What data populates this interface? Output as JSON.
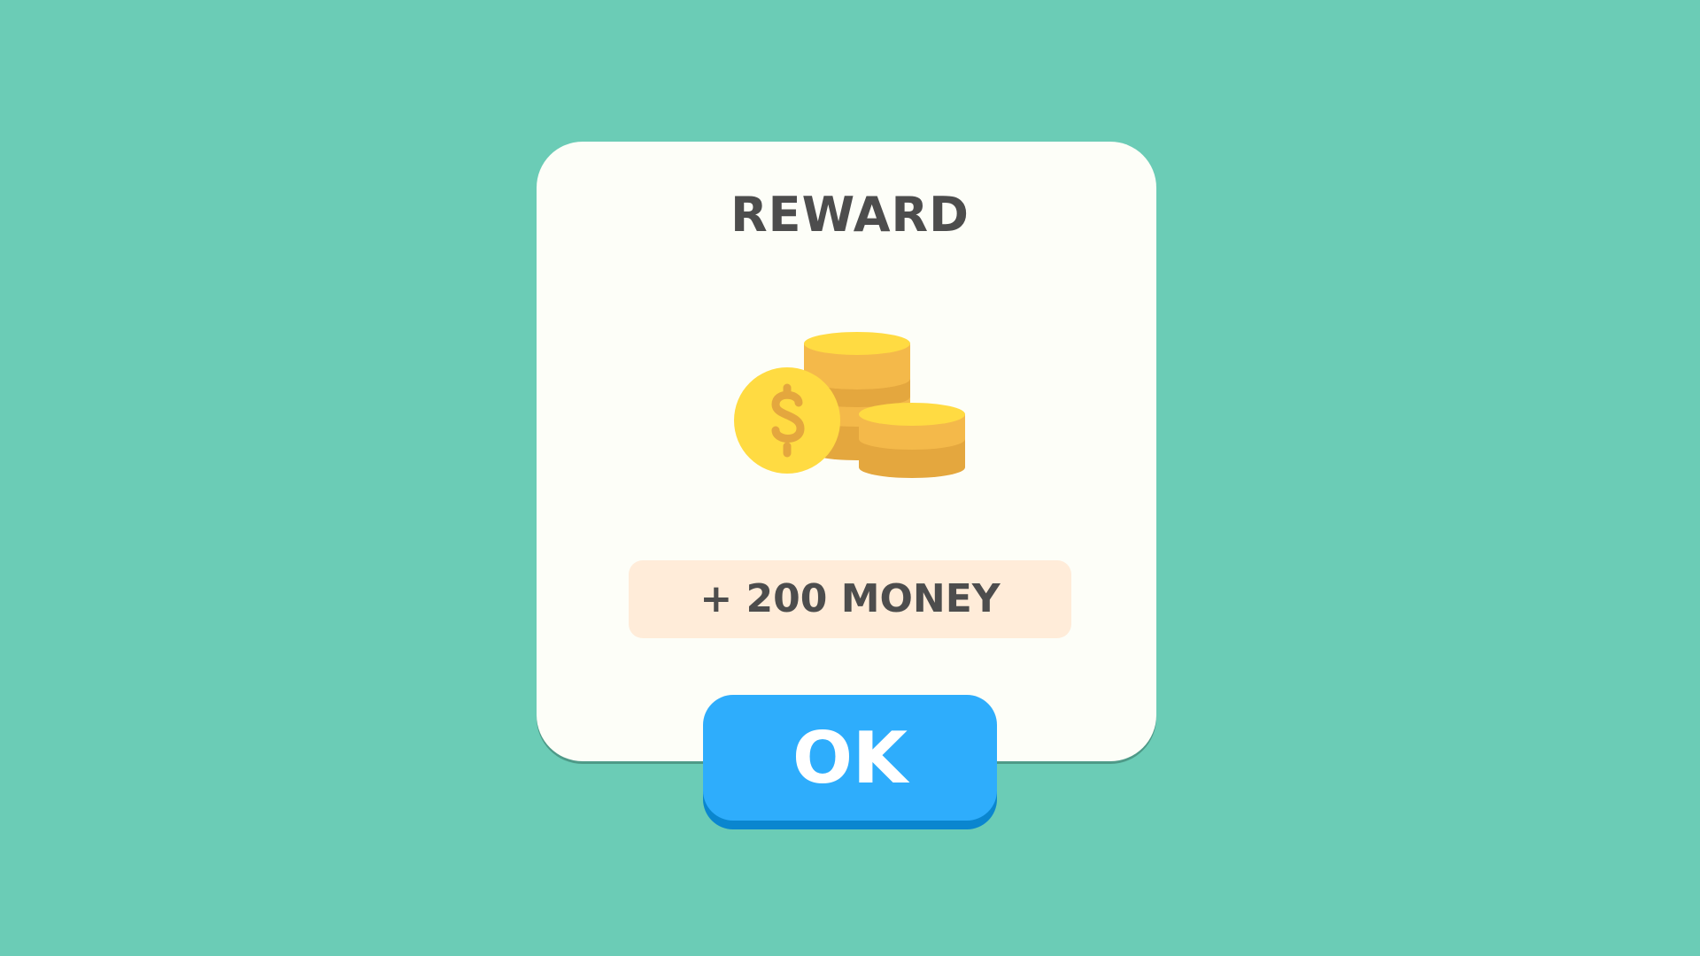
{
  "dialog": {
    "title": "REWARD",
    "reward_icon": "coins-stack-icon",
    "amount_text": "+ 200 MONEY",
    "ok_label": "OK"
  },
  "colors": {
    "background": "#6bccb6",
    "dialog": "#fdfef8",
    "amount_box": "#ffecd9",
    "button": "#2eadfc",
    "button_shadow": "#0a86cf",
    "text": "#4d4d4d",
    "coin_top": "#ffdb42",
    "coin_mid": "#f4b94a",
    "coin_dark": "#e4a73e"
  }
}
